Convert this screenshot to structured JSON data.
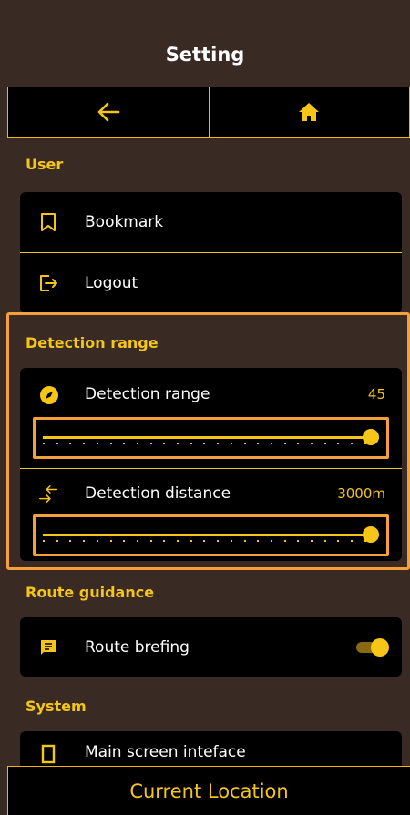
{
  "header": {
    "title": "Setting"
  },
  "nav": {
    "back_icon": "arrow-left-icon",
    "home_icon": "home-icon"
  },
  "colors": {
    "accent": "#f5c518",
    "highlight": "#f5a03a",
    "background": "#3a2a24",
    "card": "#000000"
  },
  "sections": {
    "user": {
      "title": "User",
      "items": [
        {
          "label": "Bookmark",
          "icon": "bookmark-icon"
        },
        {
          "label": "Logout",
          "icon": "logout-icon"
        }
      ]
    },
    "detection": {
      "title": "Detection range",
      "range": {
        "label": "Detection range",
        "value": "45",
        "icon": "compass-icon",
        "fraction": 1.0
      },
      "distance": {
        "label": "Detection distance",
        "value": "3000m",
        "icon": "arrows-in-out-icon",
        "fraction": 1.0
      }
    },
    "route": {
      "title": "Route guidance",
      "briefing": {
        "label": "Route brefing",
        "icon": "message-icon",
        "enabled": true
      }
    },
    "system": {
      "title": "System",
      "main_screen": {
        "label": "Main screen inteface",
        "icon": "phone-icon"
      }
    }
  },
  "bottom": {
    "label": "Current Location"
  }
}
